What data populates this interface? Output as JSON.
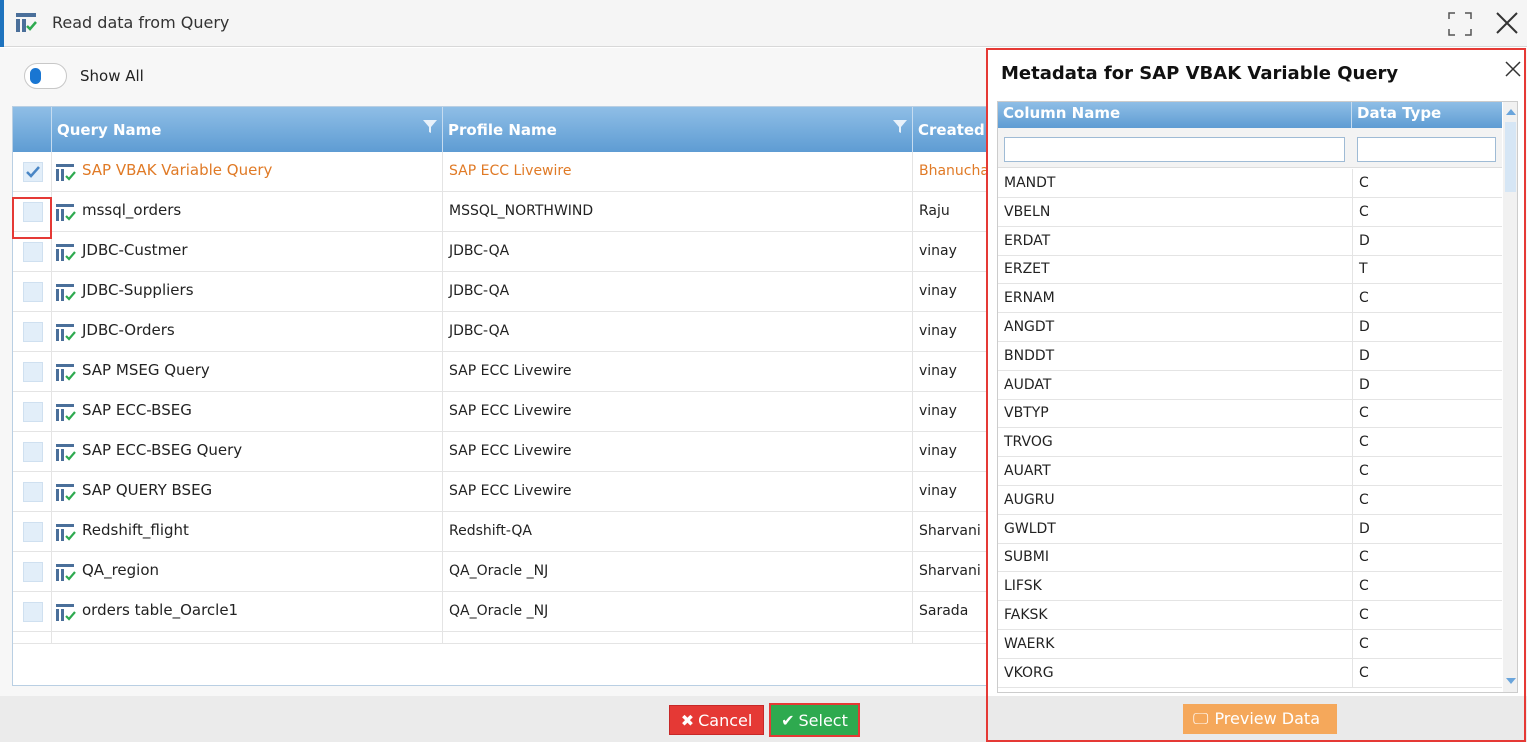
{
  "window": {
    "title": "Read data from Query"
  },
  "toolbar": {
    "show_all_label": "Show All",
    "show_all_on": true
  },
  "grid": {
    "columns": [
      "Query Name",
      "Profile Name",
      "Created"
    ],
    "rows": [
      {
        "name": "SAP VBAK Variable Query",
        "profile": "SAP ECC Livewire",
        "created": "Bhanucha",
        "selected": true
      },
      {
        "name": "mssql_orders",
        "profile": "MSSQL_NORTHWIND",
        "created": "Raju",
        "selected": false
      },
      {
        "name": "JDBC-Custmer",
        "profile": "JDBC-QA",
        "created": "vinay",
        "selected": false
      },
      {
        "name": "JDBC-Suppliers",
        "profile": "JDBC-QA",
        "created": "vinay",
        "selected": false
      },
      {
        "name": "JDBC-Orders",
        "profile": "JDBC-QA",
        "created": "vinay",
        "selected": false
      },
      {
        "name": "SAP MSEG Query",
        "profile": "SAP ECC Livewire",
        "created": "vinay",
        "selected": false
      },
      {
        "name": "SAP ECC-BSEG",
        "profile": "SAP ECC Livewire",
        "created": "vinay",
        "selected": false
      },
      {
        "name": "SAP ECC-BSEG Query",
        "profile": "SAP ECC Livewire",
        "created": "vinay",
        "selected": false
      },
      {
        "name": "SAP QUERY BSEG",
        "profile": "SAP ECC Livewire",
        "created": "vinay",
        "selected": false
      },
      {
        "name": "Redshift_flight",
        "profile": "Redshift-QA",
        "created": "Sharvani",
        "selected": false
      },
      {
        "name": "QA_region",
        "profile": "QA_Oracle _NJ",
        "created": "Sharvani",
        "selected": false
      },
      {
        "name": "orders table_Oarcle1",
        "profile": "QA_Oracle _NJ",
        "created": "Sarada",
        "selected": false
      }
    ]
  },
  "buttons": {
    "cancel": "Cancel",
    "select": "Select"
  },
  "metadata": {
    "title": "Metadata for SAP VBAK Variable Query",
    "columns": [
      "Column Name",
      "Data Type"
    ],
    "rows": [
      {
        "name": "MANDT",
        "type": "C"
      },
      {
        "name": "VBELN",
        "type": "C"
      },
      {
        "name": "ERDAT",
        "type": "D"
      },
      {
        "name": "ERZET",
        "type": "T"
      },
      {
        "name": "ERNAM",
        "type": "C"
      },
      {
        "name": "ANGDT",
        "type": "D"
      },
      {
        "name": "BNDDT",
        "type": "D"
      },
      {
        "name": "AUDAT",
        "type": "D"
      },
      {
        "name": "VBTYP",
        "type": "C"
      },
      {
        "name": "TRVOG",
        "type": "C"
      },
      {
        "name": "AUART",
        "type": "C"
      },
      {
        "name": "AUGRU",
        "type": "C"
      },
      {
        "name": "GWLDT",
        "type": "D"
      },
      {
        "name": "SUBMI",
        "type": "C"
      },
      {
        "name": "LIFSK",
        "type": "C"
      },
      {
        "name": "FAKSK",
        "type": "C"
      },
      {
        "name": "WAERK",
        "type": "C"
      },
      {
        "name": "VKORG",
        "type": "C"
      }
    ],
    "preview_label": "Preview Data"
  },
  "colors": {
    "accent": "#1e73be",
    "selected_text": "#e07a26",
    "cancel": "#e53935",
    "select": "#2eaa4f",
    "preview": "#f5a85b"
  }
}
